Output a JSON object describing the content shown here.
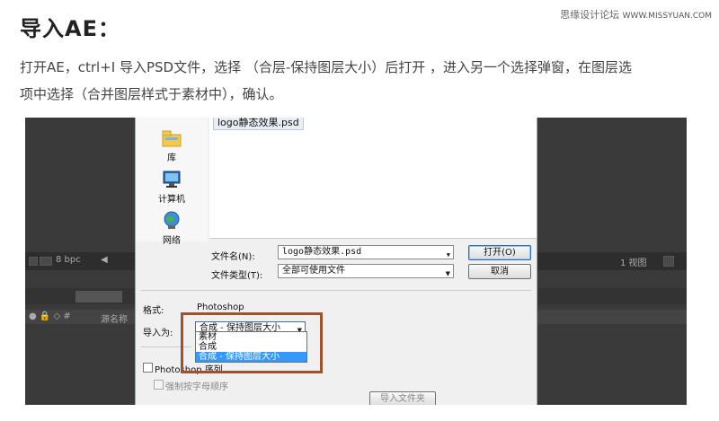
{
  "article": {
    "heading": "导入AE：",
    "site_name": "思缘设计论坛",
    "site_url": "WWW.MISSYUAN.COM",
    "paragraph_line1": "打开AE，ctrl+I 导入PSD文件，选择 （合层-保持图层大小）后打开 ，进入另一个选择弹窗，在图层选",
    "paragraph_line2": "项中选择（合并图层样式于素材中），确认。"
  },
  "ae_background": {
    "bpc_label": "8 bpc",
    "source_name_col": "源名称",
    "view_label": "1 视图"
  },
  "dialog": {
    "places": [
      {
        "label": "库",
        "icon": "library-icon"
      },
      {
        "label": "计算机",
        "icon": "computer-icon"
      },
      {
        "label": "网络",
        "icon": "network-icon"
      }
    ],
    "file_item": "logo静态效果.psd",
    "filename_label": "文件名(N):",
    "filename_value": "logo静态效果.psd",
    "filetype_label": "文件类型(T):",
    "filetype_value": "全部可使用文件",
    "open_button": "打开(O)",
    "cancel_button": "取消",
    "format_label": "格式:",
    "format_value": "Photoshop",
    "import_as_label": "导入为:",
    "import_as_value": "合成 - 保持图层大小",
    "import_as_options": [
      "素材",
      "合成",
      "合成 - 保持图层大小"
    ],
    "import_as_selected_index": 2,
    "photoshop_sequence_label": "Photoshop 序列",
    "force_alpha_label": "强制按字母顺序",
    "import_folder_button": "导入文件夹"
  },
  "colors": {
    "highlight_box": "#a0522d",
    "selected_option": "#3399ff",
    "ae_panel": "#3a3a3a"
  }
}
